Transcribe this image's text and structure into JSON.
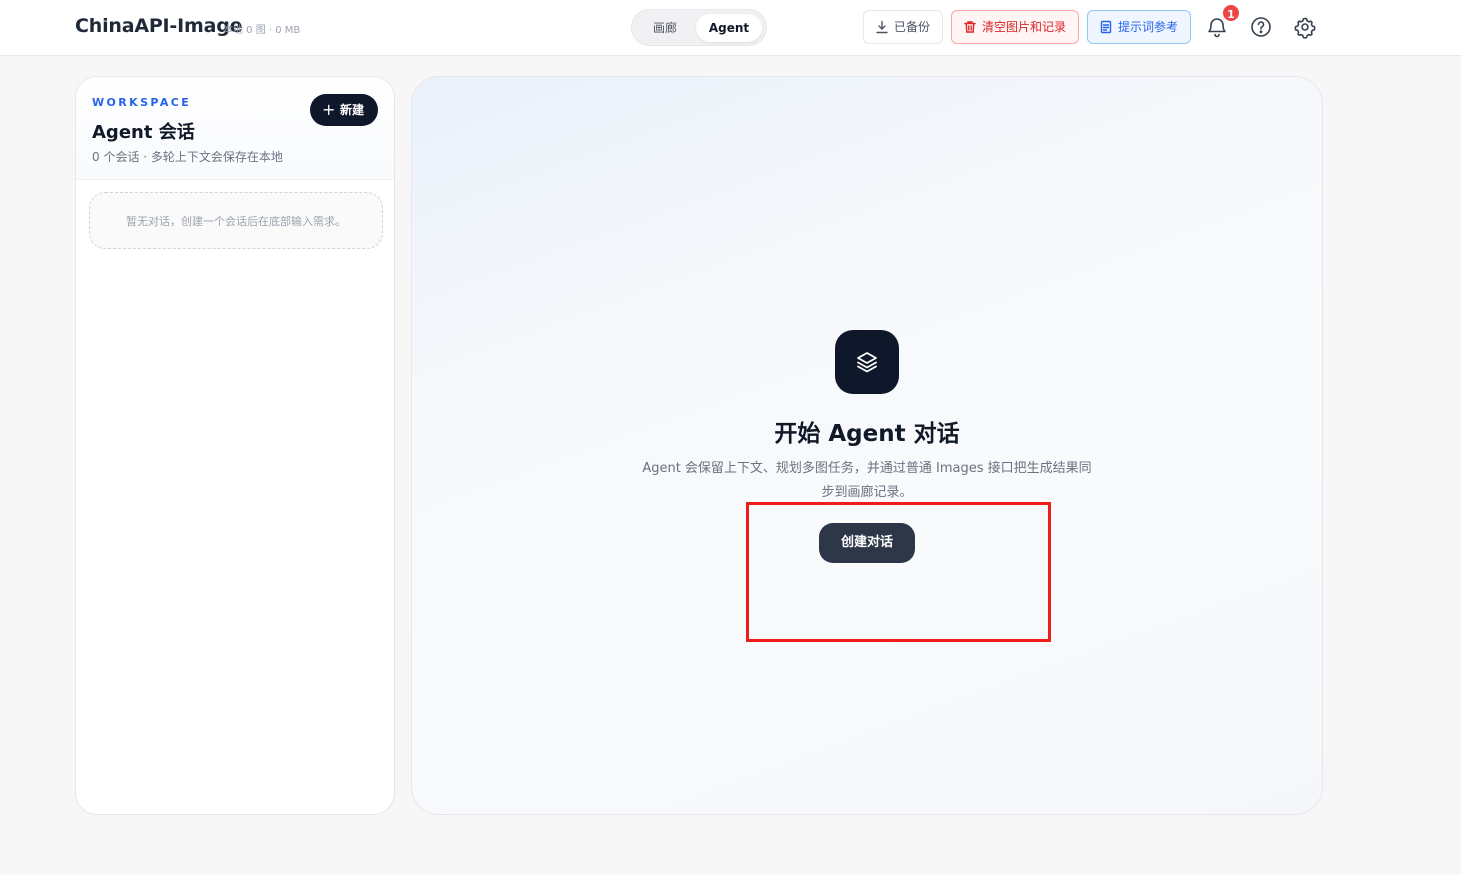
{
  "header": {
    "app_title": "ChinaAPI-Image",
    "meta": "本地 0 图 · 0 MB",
    "tabs": [
      {
        "label": "画廊",
        "active": false
      },
      {
        "label": "Agent",
        "active": true
      }
    ],
    "backup_label": "已备份",
    "clear_label": "清空图片和记录",
    "prompt_label": "提示词参考",
    "notification_count": "1",
    "icons": [
      "download-icon",
      "trash-icon",
      "document-icon",
      "bell-icon",
      "help-icon",
      "gear-icon"
    ]
  },
  "sidebar": {
    "section_label": "WORKSPACE",
    "title": "Agent 会话",
    "subtitle": "0 个会话 · 多轮上下文会保存在本地",
    "new_label": "新建",
    "empty_text": "暂无对话，创建一个会话后在底部输入需求。"
  },
  "main": {
    "title": "开始 Agent 对话",
    "description": "Agent 会保留上下文、规划多图任务，并通过普通 Images 接口把生成结果同步到画廊记录。",
    "create_label": "创建对话"
  },
  "colors": {
    "accent_blue": "#2563eb",
    "danger_red": "#dc2626",
    "dark": "#0f172a",
    "highlight": "#ef1c1c"
  }
}
